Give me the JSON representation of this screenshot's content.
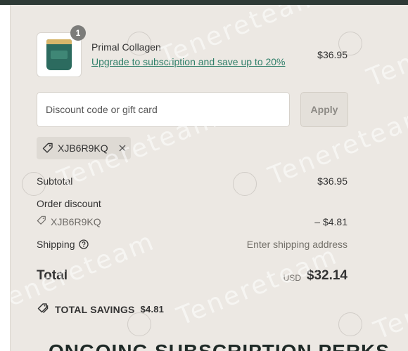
{
  "product": {
    "quantity": "1",
    "name": "Primal Collagen",
    "upgrade_link": "Upgrade to subscription and save up to 20%",
    "price": "$36.95"
  },
  "discount": {
    "placeholder": "Discount code or gift card",
    "value": "",
    "apply_label": "Apply",
    "applied_code": "XJB6R9KQ"
  },
  "summary": {
    "subtotal_label": "Subtotal",
    "subtotal_value": "$36.95",
    "order_discount_label": "Order discount",
    "discount_code": "XJB6R9KQ",
    "discount_value": "– $4.81",
    "shipping_label": "Shipping",
    "shipping_value": "Enter shipping address",
    "total_label": "Total",
    "total_currency": "USD",
    "total_value": "$32.14",
    "savings_label": "TOTAL SAVINGS",
    "savings_value": "$4.81"
  },
  "perks_heading": "ONGOING SUBSCRIPTION PERKS",
  "watermark": {
    "text": "Tenereteam",
    "logo_text": "tenere"
  },
  "colors": {
    "panel_bg": "#ece8e3",
    "link": "#2f7f69",
    "top_bar": "#2e3a36"
  }
}
